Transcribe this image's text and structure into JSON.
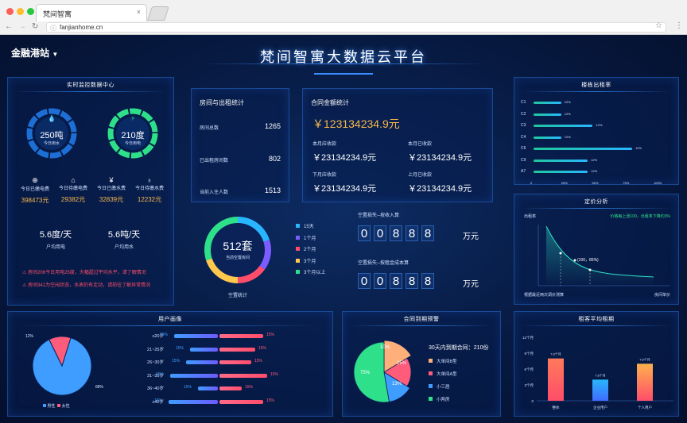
{
  "browser": {
    "tab_title": "梵间智寓",
    "url": "fanjianhome.cn"
  },
  "header": {
    "title": "梵间智寓大数据云平台",
    "site": "金融港站"
  },
  "monitor": {
    "title": "实时监控数据中心",
    "water": {
      "value": "250吨",
      "label": "今日用水"
    },
    "power": {
      "value": "210度",
      "label": "今日用电"
    },
    "stats": [
      {
        "label": "今日已缴电费",
        "value": "398473元",
        "icon": "search-money-icon"
      },
      {
        "label": "今日待缴电费",
        "value": "29382元",
        "icon": "house-money-icon"
      },
      {
        "label": "今日已缴水费",
        "value": "32839元",
        "icon": "yen-icon"
      },
      {
        "label": "今日待缴水费",
        "value": "12232元",
        "icon": "water-drop-icon"
      }
    ],
    "avg_power": {
      "value": "5.6度/天",
      "label": "户均用电"
    },
    "avg_water": {
      "value": "5.6吨/天",
      "label": "户均用水"
    },
    "alerts": [
      "房间206今日用电25度，大幅超过平均水平，请了解情况",
      "房间341为空闲状态，水表仍有走动，请前往了解异常情况"
    ]
  },
  "rooms": {
    "title": "房间与出租统计",
    "rows": [
      {
        "label": "房间总数",
        "value": "1265"
      },
      {
        "label": "已出租房间数",
        "value": "802"
      },
      {
        "label": "当前入住人数",
        "value": "1513"
      }
    ]
  },
  "contract": {
    "title": "合同金额统计",
    "total": "￥123134234.9元",
    "items": [
      {
        "label": "本月应收款",
        "value": "￥23134234.9元"
      },
      {
        "label": "本月已收款",
        "value": "￥23134234.9元"
      },
      {
        "label": "下月应收款",
        "value": "￥23134234.9元"
      },
      {
        "label": "上月已收款",
        "value": "￥23134234.9元"
      }
    ]
  },
  "vacancy": {
    "center_value": "512套",
    "center_label": "当前空置房间",
    "caption": "空置统计",
    "legend": [
      {
        "label": "15天",
        "color": "#29b6ff",
        "share": 0.2
      },
      {
        "label": "1个月",
        "color": "#7b5cff",
        "share": 0.15
      },
      {
        "label": "2个月",
        "color": "#ff4d6a",
        "share": 0.15
      },
      {
        "label": "3个月",
        "color": "#ffc94d",
        "share": 0.2
      },
      {
        "label": "3个月以上",
        "color": "#2ee08a",
        "share": 0.3
      }
    ]
  },
  "loss": {
    "income_title": "空置损失--按收入算",
    "cost_title": "空置损失--按租金成本算",
    "income_digits": [
      "0",
      "0",
      "8",
      "8",
      "8"
    ],
    "cost_digits": [
      "0",
      "0",
      "8",
      "8",
      "8"
    ],
    "unit": "万元"
  },
  "building": {
    "title": "楼栋出租率",
    "rows": [
      {
        "name": "C1",
        "value": 12,
        "label": "12%"
      },
      {
        "name": "C2",
        "value": 12,
        "label": "12%"
      },
      {
        "name": "C3",
        "value": 12,
        "label": "12%"
      },
      {
        "name": "C4",
        "value": 12,
        "label": "12%"
      },
      {
        "name": "C6",
        "value": 12,
        "label": "12%"
      },
      {
        "name": "C9",
        "value": 12,
        "label": "12%"
      },
      {
        "name": "A7",
        "value": 12,
        "label": "12%"
      }
    ],
    "ticks": [
      "0",
      "25%",
      "50%",
      "75%",
      "100%"
    ]
  },
  "pricing": {
    "title": "定价分析",
    "ylabel": "出租率",
    "note": "价格每上涨100，出租率下降约3%",
    "point": "(100，85%)",
    "xlabel_left": "根据最近两次调价测算",
    "xlabel_right": "房间单价"
  },
  "users": {
    "title": "用户画像",
    "pie": [
      {
        "label": "男性",
        "value": 88,
        "color": "#3f9dff"
      },
      {
        "label": "女性",
        "value": 12,
        "color": "#ff5b7a"
      }
    ],
    "pie_labels": [
      "12%",
      "88%"
    ],
    "ages": [
      {
        "label": "≤20岁",
        "male": "15%",
        "female": "15%"
      },
      {
        "label": "21~25岁",
        "male": "15%",
        "female": "15%"
      },
      {
        "label": "26~30岁",
        "male": "15%",
        "female": "15%"
      },
      {
        "label": "31~35岁",
        "male": "15%",
        "female": "15%"
      },
      {
        "label": "36~40岁",
        "male": "15%",
        "female": "15%"
      },
      {
        "label": "≥40岁",
        "male": "15%",
        "female": "15%"
      }
    ]
  },
  "expiry": {
    "title": "合同到期预警",
    "heading": "30天内到期合同：210份",
    "pie": [
      {
        "label": "大单间B型",
        "value": 10,
        "color": "#ffb07a"
      },
      {
        "label": "大单间A型",
        "value": 15,
        "color": "#ff5b7a"
      },
      {
        "label": "小三居",
        "value": 13,
        "color": "#3f9dff"
      },
      {
        "label": "小两房",
        "value": 75,
        "color": "#2ee08a"
      }
    ],
    "pie_labels": [
      "10%",
      "15%",
      "13%",
      "75%"
    ]
  },
  "lease": {
    "title": "租客平均租期",
    "yticks": [
      "12个月",
      "9个月",
      "6个月",
      "3个月",
      "0"
    ],
    "bars": [
      {
        "name": "整体",
        "value": 8,
        "label": "7.8个月"
      },
      {
        "name": "企业用户",
        "value": 4,
        "label": "7.8个月"
      },
      {
        "name": "个人用户",
        "value": 7,
        "label": "7.8个月"
      }
    ]
  },
  "colors": {
    "bg": "#071a42",
    "accent": "#2a78d8",
    "gold": "#f7b84b",
    "cyan": "#29d4ff",
    "red": "#ff4d6a"
  }
}
